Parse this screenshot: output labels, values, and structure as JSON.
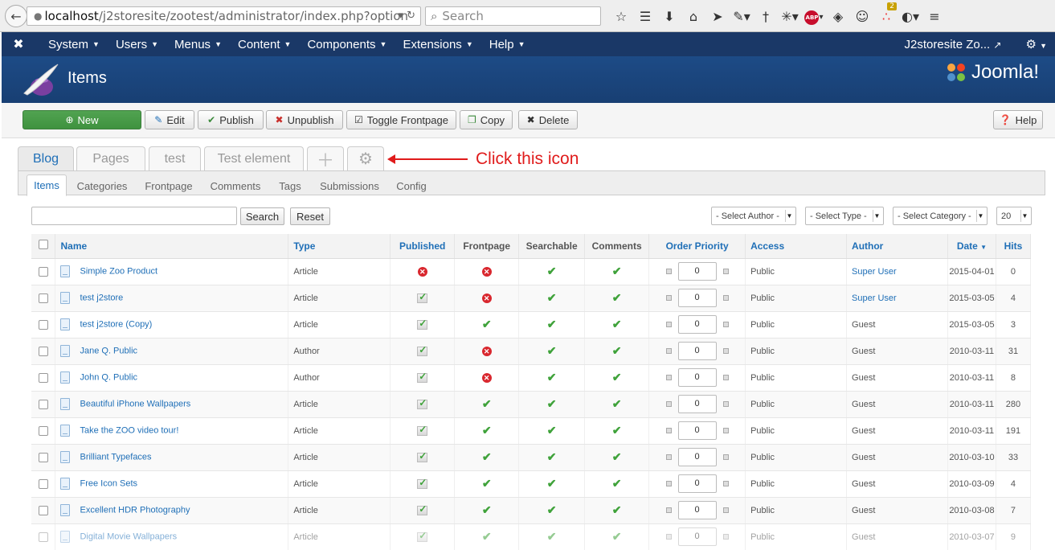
{
  "browser": {
    "url_host": "localhost",
    "url_path": "/j2storesite/zootest/administrator/index.php?option",
    "search_placeholder": "Search",
    "notification_count": "2",
    "abp_label": "ABP"
  },
  "jnav": {
    "menu": [
      {
        "label": "System"
      },
      {
        "label": "Users"
      },
      {
        "label": "Menus"
      },
      {
        "label": "Content"
      },
      {
        "label": "Components"
      },
      {
        "label": "Extensions"
      },
      {
        "label": "Help"
      }
    ],
    "site_link": "J2storesite Zo..."
  },
  "header": {
    "title": "Items",
    "brand": "Joomla!"
  },
  "toolbar": {
    "new": "New",
    "edit": "Edit",
    "publish": "Publish",
    "unpublish": "Unpublish",
    "toggle_frontpage": "Toggle Frontpage",
    "copy": "Copy",
    "delete": "Delete",
    "help": "Help"
  },
  "app_tabs": [
    "Blog",
    "Pages",
    "test",
    "Test element"
  ],
  "annotation": "Click this icon",
  "sub_tabs": [
    "Items",
    "Categories",
    "Frontpage",
    "Comments",
    "Tags",
    "Submissions",
    "Config"
  ],
  "filters": {
    "search_button": "Search",
    "reset_button": "Reset",
    "author": "- Select Author -",
    "type": "- Select Type -",
    "category": "- Select Category -",
    "limit": "20"
  },
  "columns": {
    "name": "Name",
    "type": "Type",
    "published": "Published",
    "frontpage": "Frontpage",
    "searchable": "Searchable",
    "comments": "Comments",
    "order_priority": "Order Priority",
    "access": "Access",
    "author": "Author",
    "date": "Date",
    "hits": "Hits"
  },
  "rows": [
    {
      "name": "Simple Zoo Product",
      "type": "Article",
      "published": false,
      "frontpage": false,
      "order": "0",
      "access": "Public",
      "author": "Super User",
      "author_link": true,
      "date": "2015-04-01",
      "hits": "0"
    },
    {
      "name": "test j2store",
      "type": "Article",
      "published": true,
      "frontpage": false,
      "order": "0",
      "access": "Public",
      "author": "Super User",
      "author_link": true,
      "date": "2015-03-05",
      "hits": "4"
    },
    {
      "name": "test j2store (Copy)",
      "type": "Article",
      "published": true,
      "frontpage": true,
      "order": "0",
      "access": "Public",
      "author": "Guest",
      "author_link": false,
      "date": "2015-03-05",
      "hits": "3"
    },
    {
      "name": "Jane Q. Public",
      "type": "Author",
      "published": true,
      "frontpage": false,
      "order": "0",
      "access": "Public",
      "author": "Guest",
      "author_link": false,
      "date": "2010-03-11",
      "hits": "31"
    },
    {
      "name": "John Q. Public",
      "type": "Author",
      "published": true,
      "frontpage": false,
      "order": "0",
      "access": "Public",
      "author": "Guest",
      "author_link": false,
      "date": "2010-03-11",
      "hits": "8"
    },
    {
      "name": "Beautiful iPhone Wallpapers",
      "type": "Article",
      "published": true,
      "frontpage": true,
      "order": "0",
      "access": "Public",
      "author": "Guest",
      "author_link": false,
      "date": "2010-03-11",
      "hits": "280"
    },
    {
      "name": "Take the ZOO video tour!",
      "type": "Article",
      "published": true,
      "frontpage": true,
      "order": "0",
      "access": "Public",
      "author": "Guest",
      "author_link": false,
      "date": "2010-03-11",
      "hits": "191"
    },
    {
      "name": "Brilliant Typefaces",
      "type": "Article",
      "published": true,
      "frontpage": true,
      "order": "0",
      "access": "Public",
      "author": "Guest",
      "author_link": false,
      "date": "2010-03-10",
      "hits": "33"
    },
    {
      "name": "Free Icon Sets",
      "type": "Article",
      "published": true,
      "frontpage": true,
      "order": "0",
      "access": "Public",
      "author": "Guest",
      "author_link": false,
      "date": "2010-03-09",
      "hits": "4"
    },
    {
      "name": "Excellent HDR Photography",
      "type": "Article",
      "published": true,
      "frontpage": true,
      "order": "0",
      "access": "Public",
      "author": "Guest",
      "author_link": false,
      "date": "2010-03-08",
      "hits": "7"
    },
    {
      "name": "Digital Movie Wallpapers",
      "type": "Article",
      "published": true,
      "frontpage": true,
      "order": "0",
      "access": "Public",
      "author": "Guest",
      "author_link": false,
      "date": "2010-03-07",
      "hits": "9"
    }
  ]
}
